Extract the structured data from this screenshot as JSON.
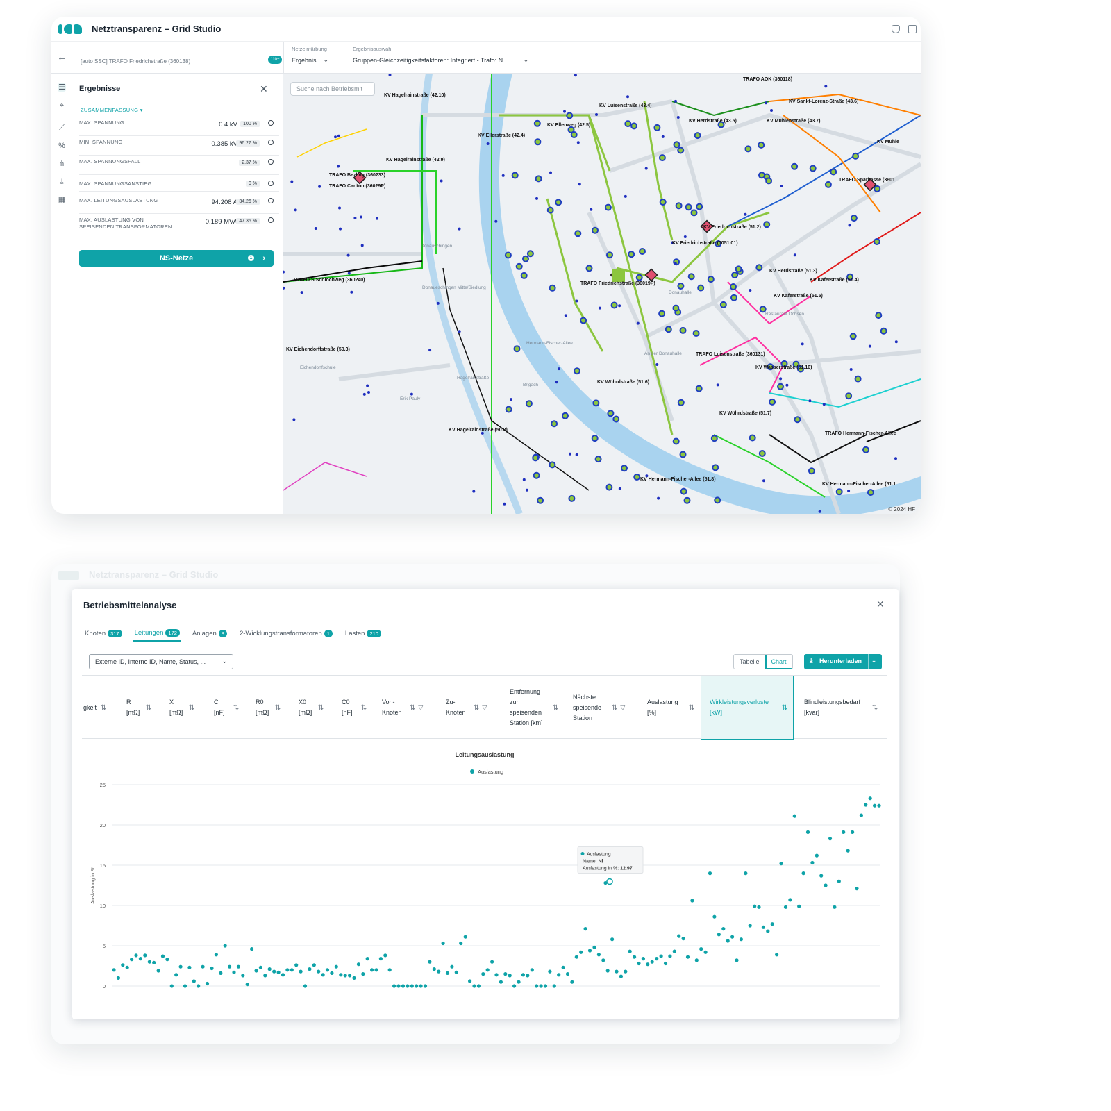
{
  "app": {
    "title": "Netztransparenz – Grid Studio"
  },
  "subheader": {
    "asset": "[auto SSC] TRAFO Friedrichstraße (360138)",
    "badge": "110+",
    "coloring_label": "Netzeinfärbung",
    "coloring_value": "Ergebnis",
    "result_label": "Ergebnisauswahl",
    "result_value": "Gruppen-Gleichzeitigkeitsfaktoren: Integriert - Trafo: N..."
  },
  "results_panel": {
    "title": "Ergebnisse",
    "section": "ZUSAMMENFASSUNG",
    "metrics": [
      {
        "label": "MAX. SPANNUNG",
        "value": "0.4 kV",
        "pct": "100 %"
      },
      {
        "label": "MIN. SPANNUNG",
        "value": "0.385 kV",
        "pct": "96.27 %"
      },
      {
        "label": "MAX. SPANNUNGSFALL",
        "value": "",
        "pct": "2.37 %"
      },
      {
        "label": "MAX. SPANNUNGSANSTIEG",
        "value": "",
        "pct": "0 %"
      },
      {
        "label": "MAX. LEITUNGSAUSLASTUNG",
        "value": "94.208 A",
        "pct": "34.26 %"
      },
      {
        "label": "MAX. AUSLASTUNG VON SPEISENDEN TRANSFORMATOREN",
        "value": "0.189 MVA",
        "pct": "47.35 %"
      }
    ],
    "button": "NS-Netze",
    "button_count": "1"
  },
  "map": {
    "search_placeholder": "Suche nach Betriebsmit",
    "copyright": "© 2024 HF",
    "labels": [
      "KV Hagelrainstraße (42.10)",
      "KV Luisenstraße (43.4)",
      "TRAFO AOK (360118)",
      "KV Sankt-Lorenz-Straße (43.6)",
      "KV Ellerstraße (42.4)",
      "KV Ellenweg (42.5)",
      "KV Herdstraße (43.5)",
      "KV Mühlenstraße (43.7)",
      "KV Mühle",
      "KV Hagelrainstraße (42.9)",
      "TRAFO Bezling (360233)",
      "TRAFO Carlton (36029P)",
      "TRAFO Sparkasse (3601",
      "KV Friedrichstraße (51.2)",
      "KV Friedrichstraße (0051.01)",
      "TRAFO S Schlochweg (360240)",
      "TRAFO Friedrichstraße (36019P)",
      "KV Herdstraße (51.3)",
      "KV Käferstraße (51.4)",
      "KV Käferstraße (51.5)",
      "KV Eichendorffstraße (50.3)",
      "TRAFO Luisenstraße (360131)",
      "KV Wasserstraße (51.10)",
      "KV Wöhrdstraße (51.6)",
      "KV Wöhrdstraße (51.7)",
      "KV Hagelrainstraße (50.2)",
      "TRAFO Hermann-Fischer-Allee",
      "KV Hermann-Fischer-Allee (51.8)",
      "KV Hermann-Fischer-Allee (51.1"
    ],
    "place_labels": [
      "Donauschingen",
      "Donaueschingen Mitte/Siedlung",
      "Eichendorffschule",
      "Hermann-Fischer-Allee",
      "Brigach",
      "Hagelrainstraße",
      "An der Donauhalle",
      "Donauhalle",
      "Restaurant Ochsen",
      "Erik Pauly"
    ]
  },
  "bg_window": {
    "title": "Netztransparenz – Grid Studio"
  },
  "modal": {
    "title": "Betriebsmittelanalyse",
    "tabs": [
      {
        "label": "Knoten",
        "count": "317"
      },
      {
        "label": "Leitungen",
        "count": "172"
      },
      {
        "label": "Anlagen",
        "count": "8"
      },
      {
        "label": "2-Wicklungstransformatoren",
        "count": "1"
      },
      {
        "label": "Lasten",
        "count": "210"
      }
    ],
    "filter_value": "Externe ID, Interne ID, Name, Status, ...",
    "view_table": "Tabelle",
    "view_chart": "Chart",
    "download": "Herunterladen",
    "columns": [
      "gkeit",
      "R [mΩ]",
      "X [mΩ]",
      "C [nF]",
      "R0 [mΩ]",
      "X0 [mΩ]",
      "C0 [nF]",
      "Von-Knoten",
      "Zu-Knoten",
      "Entfernung zur speisenden Station [km]",
      "Nächste speisende Station",
      "Auslastung [%]",
      "Wirkleistungsverluste [kW]",
      "Blindleistungsbedarf [kvar]"
    ]
  },
  "chart_data": {
    "type": "scatter",
    "title": "Leitungsauslastung",
    "ylabel": "Auslastung in %",
    "ylim": [
      0,
      25
    ],
    "yticks": [
      0,
      5,
      10,
      15,
      20,
      25
    ],
    "grid": true,
    "legend": "top-center",
    "series": [
      {
        "name": "Auslastung",
        "color": "#0fa3a8",
        "values": [
          2.0,
          1.0,
          2.6,
          2.3,
          3.3,
          3.8,
          3.4,
          3.8,
          3.0,
          2.9,
          1.9,
          3.7,
          3.3,
          0,
          1.4,
          2.4,
          0,
          2.3,
          0.6,
          0,
          2.4,
          0.3,
          2.2,
          3.9,
          1.6,
          5.0,
          2.4,
          1.7,
          2.4,
          1.3,
          0.2,
          4.6,
          1.9,
          2.3,
          1.3,
          2.1,
          1.8,
          1.7,
          1.4,
          2.0,
          2.0,
          2.6,
          1.8,
          0,
          2.1,
          2.6,
          1.8,
          1.4,
          2.0,
          1.6,
          2.4,
          1.4,
          1.3,
          1.3,
          1.0,
          2.7,
          1.5,
          3.4,
          2.0,
          2.0,
          3.4,
          3.8,
          2.0,
          0,
          0,
          0,
          0,
          0,
          0,
          0,
          0,
          3.0,
          2.1,
          1.8,
          5.3,
          1.6,
          2.4,
          1.7,
          5.3,
          6.1,
          0.6,
          0,
          0,
          1.5,
          2.0,
          3.0,
          1.4,
          0.5,
          1.5,
          1.3,
          0,
          0.5,
          1.4,
          1.3,
          2.0,
          0,
          0,
          0,
          1.8,
          0,
          1.4,
          2.3,
          1.5,
          0.5,
          3.6,
          4.2,
          7.1,
          4.4,
          4.8,
          3.9,
          3.2,
          1.9,
          5.8,
          1.8,
          1.2,
          1.8,
          4.3,
          3.6,
          2.8,
          3.4,
          2.7,
          3.0,
          3.4,
          3.7,
          2.8,
          3.7,
          4.3,
          6.2,
          5.9,
          3.6,
          10.6,
          3.2,
          4.6,
          4.2,
          14.0,
          8.6,
          6.4,
          7.1,
          5.6,
          6.1,
          3.2,
          5.8,
          14.0,
          7.5,
          9.9,
          9.8,
          7.3,
          6.8,
          7.7,
          3.9,
          15.2,
          9.8,
          10.7,
          21.1,
          9.9,
          14.0,
          19.1,
          15.3,
          16.2,
          13.7,
          12.5,
          18.3,
          9.8,
          13.0,
          19.1,
          16.8,
          19.1,
          12.1,
          21.2,
          22.5,
          23.3,
          22.4,
          22.4
        ]
      }
    ],
    "tooltip": {
      "series": "Auslastung",
      "name_label": "Name:",
      "name": "Nl",
      "value_label": "Auslastung in %:",
      "value": "12.97"
    }
  }
}
